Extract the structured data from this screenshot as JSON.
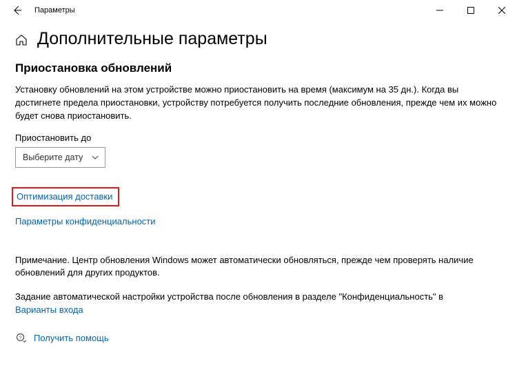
{
  "window": {
    "title": "Параметры"
  },
  "header": {
    "page_title": "Дополнительные параметры"
  },
  "section": {
    "title": "Приостановка обновлений",
    "description": "Установку обновлений на этом устройстве можно приостановить на время (максимум на 35 дн.). Когда вы достигнете предела приостановки, устройству потребуется получить последние обновления, прежде чем их можно будет снова приостановить.",
    "pause_label": "Приостановить до",
    "dropdown_value": "Выберите дату"
  },
  "links": {
    "delivery": "Оптимизация доставки",
    "privacy": "Параметры конфиденциальности",
    "signin": "Варианты входа",
    "help": "Получить помощь"
  },
  "notes": {
    "note1": "Примечание. Центр обновления Windows может автоматически обновляться, прежде чем проверять наличие обновлений для других продуктов.",
    "note2": "Задание автоматической настройки устройства после обновления в разделе \"Конфиденциальность\" в"
  }
}
